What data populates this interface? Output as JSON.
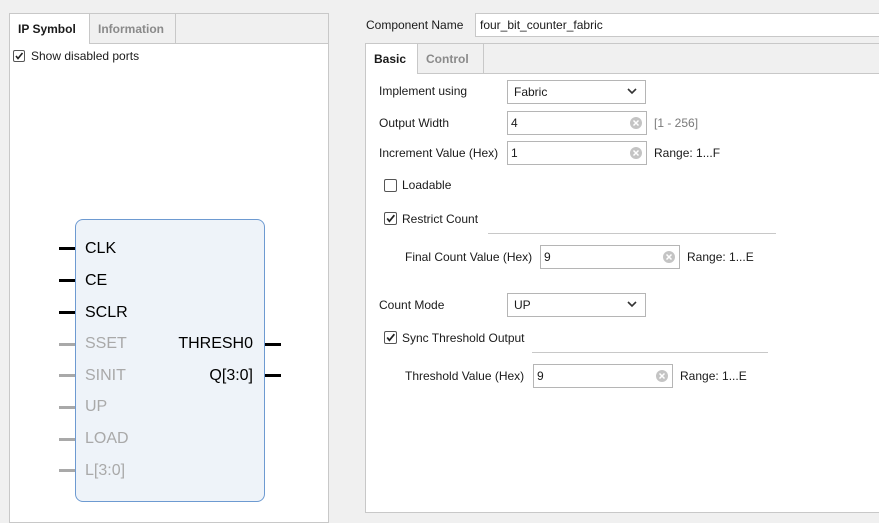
{
  "left": {
    "tabs": [
      "IP Symbol",
      "Information"
    ],
    "show_disabled_ports": {
      "label": "Show disabled ports",
      "checked": true
    },
    "symbol": {
      "inputs": [
        {
          "name": "CLK",
          "enabled": true
        },
        {
          "name": "CE",
          "enabled": true
        },
        {
          "name": "SCLR",
          "enabled": true
        },
        {
          "name": "SSET",
          "enabled": false
        },
        {
          "name": "SINIT",
          "enabled": false
        },
        {
          "name": "UP",
          "enabled": false
        },
        {
          "name": "LOAD",
          "enabled": false
        },
        {
          "name": "L[3:0]",
          "enabled": false
        }
      ],
      "outputs": [
        {
          "name": "THRESH0",
          "enabled": true
        },
        {
          "name": "Q[3:0]",
          "enabled": true
        }
      ]
    }
  },
  "right": {
    "component_name": {
      "label": "Component Name",
      "value": "four_bit_counter_fabric"
    },
    "tabs": [
      "Basic",
      "Control"
    ],
    "implement_using": {
      "label": "Implement using",
      "value": "Fabric"
    },
    "output_width": {
      "label": "Output Width",
      "value": "4",
      "hint": "[1 - 256]"
    },
    "increment_value": {
      "label": "Increment Value (Hex)",
      "value": "1",
      "hint": "Range: 1...F"
    },
    "loadable": {
      "label": "Loadable",
      "checked": false
    },
    "restrict_count": {
      "label": "Restrict Count",
      "checked": true
    },
    "final_count_value": {
      "label": "Final Count Value (Hex)",
      "value": "9",
      "hint": "Range: 1...E"
    },
    "count_mode": {
      "label": "Count Mode",
      "value": "UP"
    },
    "sync_threshold_output": {
      "label": "Sync Threshold Output",
      "checked": true
    },
    "threshold_value": {
      "label": "Threshold Value (Hex)",
      "value": "9",
      "hint": "Range: 1...E"
    }
  },
  "colors": {
    "symbol_fill": "#eef3f9",
    "symbol_border": "#6d9ad1",
    "disabled_port": "#a9a9a9"
  }
}
